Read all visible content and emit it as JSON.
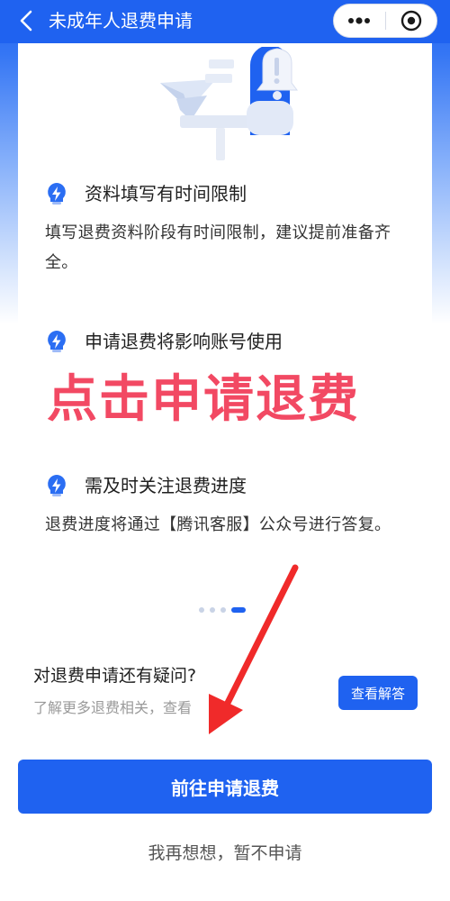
{
  "header": {
    "back_icon": "chevron-left-icon",
    "title": "未成年人退费申请",
    "more_icon": "more-dots-icon",
    "close_icon": "target-circle-icon",
    "bg_color": "#1f62f0"
  },
  "tips": [
    {
      "icon": "lightning-bulb-icon",
      "title": "资料填写有时间限制",
      "desc": "填写退费资料阶段有时间限制，建议提前准备齐全。"
    },
    {
      "icon": "lightning-bulb-icon",
      "title": "申请退费将影响账号使用",
      "desc": ""
    },
    {
      "icon": "lightning-bulb-icon",
      "title": "需及时关注退费进度",
      "desc": "退费进度将通过【腾讯客服】公众号进行答复。"
    }
  ],
  "carousel": {
    "count": 4,
    "active_index": 3
  },
  "faq": {
    "question": "对退费申请还有疑问?",
    "subtitle": "了解更多退费相关，查看",
    "button_label": "查看解答"
  },
  "actions": {
    "primary_label": "前往申请退费",
    "secondary_label": "我再想想，暂不申请"
  },
  "overlay": {
    "annotation_text": "点击申请退费",
    "annotation_color": "#f24963",
    "arrow_icon": "red-arrow-icon"
  },
  "colors": {
    "accent": "#1f62f0",
    "annotation": "#f24963"
  }
}
